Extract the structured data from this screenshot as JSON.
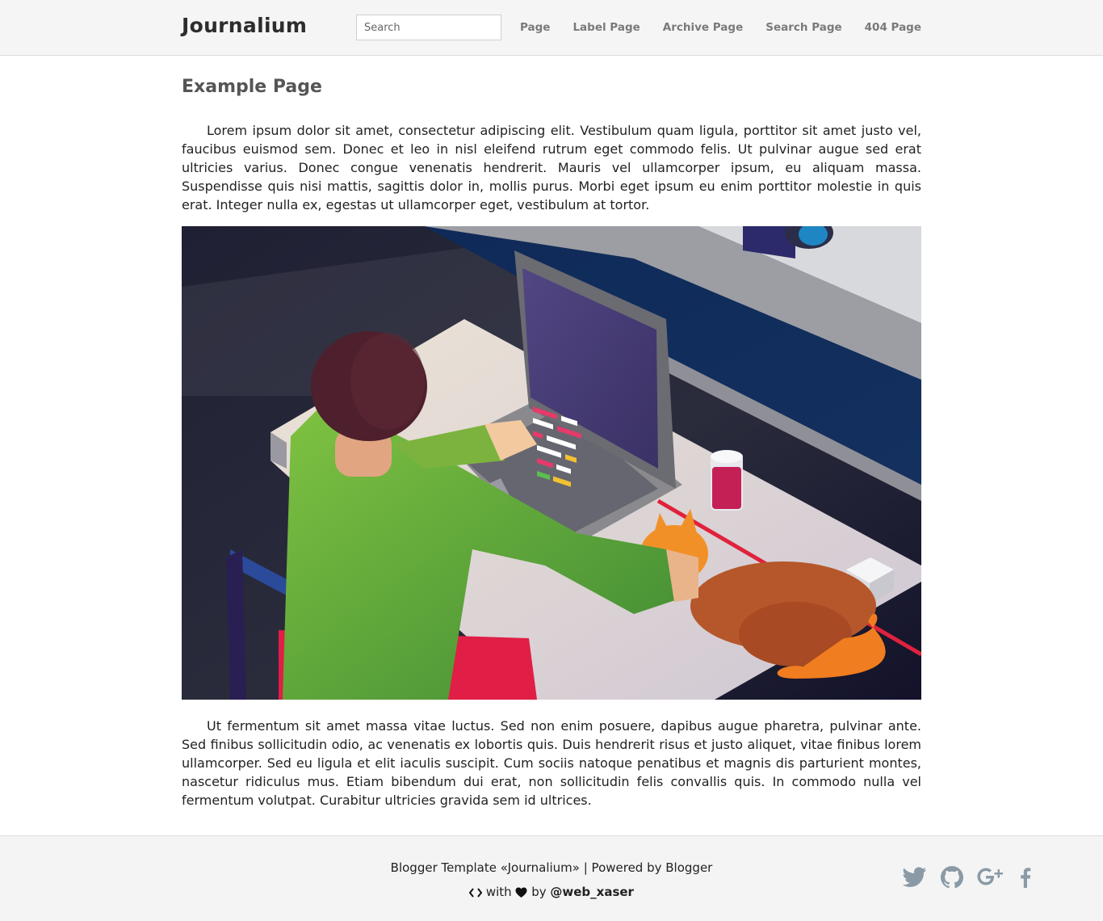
{
  "header": {
    "brand": "Journalium",
    "search_placeholder": "Search",
    "nav": [
      "Page",
      "Label Page",
      "Archive Page",
      "Search Page",
      "404 Page"
    ]
  },
  "main": {
    "title": "Example Page",
    "paragraph1": "Lorem ipsum dolor sit amet, consectetur adipiscing elit. Vestibulum quam ligula, porttitor sit amet justo vel, faucibus euismod sem. Donec et leo in nisl eleifend rutrum eget commodo felis. Ut pulvinar augue sed erat ultricies varius. Donec congue venenatis hendrerit. Mauris vel ullamcorper ipsum, eu aliquam massa. Suspendisse quis nisi mattis, sagittis dolor in, mollis purus. Morbi eget ipsum eu enim porttitor molestie in quis erat. Integer nulla ex, egestas ut ullamcorper eget, vestibulum at tortor.",
    "paragraph2": "Ut fermentum sit amet massa vitae luctus. Sed non enim posuere, dapibus augue pharetra, pulvinar ante. Sed finibus sollicitudin odio, ac venenatis ex lobortis quis. Duis hendrerit risus et justo aliquet, vitae finibus lorem ullamcorper. Sed eu ligula et elit iaculis suscipit. Cum sociis natoque penatibus et magnis dis parturient montes, nascetur ridiculus mus. Etiam bibendum dui erat, non sollicitudin felis convallis quis. In commodo nulla vel fermentum volutpat. Curabitur ultricies gravida sem id ultrices."
  },
  "footer": {
    "line1": "Blogger Template «Journalium» | Powered by Blogger",
    "with_text": "with",
    "by_text": "by",
    "author": "@web_xaser",
    "social_icons": [
      "twitter-icon",
      "github-icon",
      "google-plus-icon",
      "facebook-icon"
    ]
  },
  "colors": {
    "topbar_bg": "#f5f5f5",
    "footer_bg": "#f4f4f4",
    "nav_text": "#7a7a7a",
    "social_icon": "#8a9aa6"
  }
}
